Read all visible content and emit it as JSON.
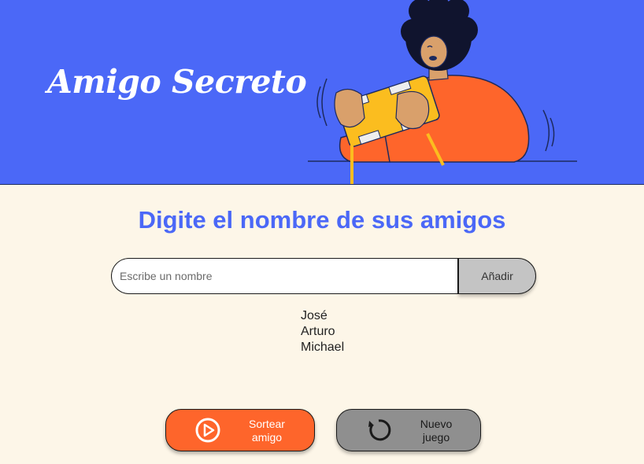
{
  "header": {
    "title": "Amigo Secreto"
  },
  "main": {
    "subtitle": "Digite el nombre de sus amigos",
    "input": {
      "placeholder": "Escribe un nombre",
      "value": ""
    },
    "add_button_label": "Añadir",
    "friends": [
      "José",
      "Arturo",
      "Michael"
    ]
  },
  "actions": {
    "draw": {
      "label_line1": "Sortear",
      "label_line2": "amigo",
      "icon": "play-circle-icon",
      "color": "#fe652b"
    },
    "new_game": {
      "label_line1": "Nuevo",
      "label_line2": "juego",
      "icon": "refresh-icon",
      "color": "#8f8f8f"
    }
  },
  "colors": {
    "header_bg": "#4b68f7",
    "page_bg": "#fdf6e8",
    "accent": "#4b68f7"
  }
}
